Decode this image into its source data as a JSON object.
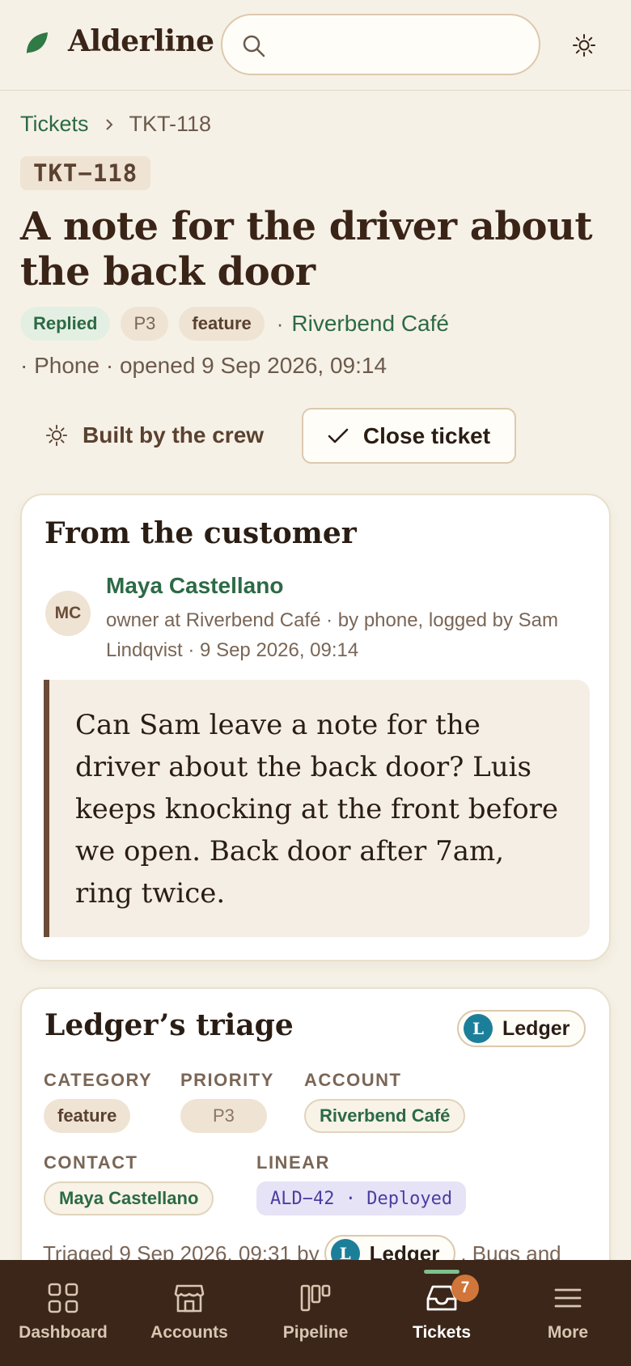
{
  "header": {
    "brand": "Alderline",
    "search_placeholder": "",
    "theme_icon": "sun-icon"
  },
  "breadcrumb": {
    "parent": "Tickets",
    "current": "TKT-118"
  },
  "ticket": {
    "id": "TKT−118",
    "title": "A note for the driver about the back door",
    "status": "Replied",
    "priority": "P3",
    "category": "feature",
    "account": "Riverbend Café",
    "meta_line": "· Phone · opened 9 Sep 2026, 09:14"
  },
  "actions": {
    "built_by": "Built by the crew",
    "close": "Close ticket"
  },
  "customer_card": {
    "title": "From the customer",
    "avatar_initials": "MC",
    "name": "Maya Castellano",
    "meta": "owner at Riverbend Café · by phone, logged by Sam Lindqvist · 9 Sep 2026, 09:14",
    "quote": "Can Sam leave a note for the driver about the back door? Luis keeps knocking at the front before we open. Back door after 7am, ring twice."
  },
  "triage_card": {
    "title": "Ledger’s triage",
    "agent_initial": "L",
    "agent_name": "Ledger",
    "fields": {
      "category_label": "CATEGORY",
      "category_value": "feature",
      "priority_label": "PRIORITY",
      "priority_value": "P3",
      "account_label": "ACCOUNT",
      "account_value": "Riverbend Café",
      "contact_label": "CONTACT",
      "contact_value": "Maya Castellano",
      "linear_label": "LINEAR",
      "linear_value": "ALD−42 · Deployed"
    },
    "triaged_prefix": "Triaged 9 Sep 2026, 09:31 by",
    "triaged_suffix": ". Bugs and"
  },
  "nav": {
    "items": [
      {
        "label": "Dashboard",
        "icon": "grid-icon"
      },
      {
        "label": "Accounts",
        "icon": "store-icon"
      },
      {
        "label": "Pipeline",
        "icon": "kanban-icon"
      },
      {
        "label": "Tickets",
        "icon": "inbox-icon",
        "badge": "7",
        "active": true
      },
      {
        "label": "More",
        "icon": "menu-icon"
      }
    ]
  },
  "colors": {
    "background": "#f6f1e6",
    "brand_green": "#2c6a45",
    "nav_bg": "#3b2619",
    "badge_orange": "#d0763a",
    "ledger_teal": "#1c7f9a"
  }
}
